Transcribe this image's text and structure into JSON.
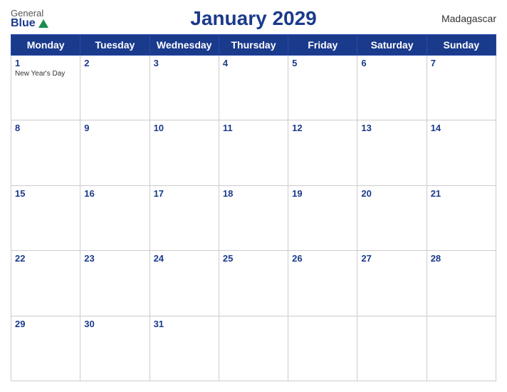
{
  "header": {
    "logo_general": "General",
    "logo_blue": "Blue",
    "title": "January 2029",
    "country": "Madagascar"
  },
  "days_of_week": [
    "Monday",
    "Tuesday",
    "Wednesday",
    "Thursday",
    "Friday",
    "Saturday",
    "Sunday"
  ],
  "weeks": [
    [
      {
        "date": "1",
        "holiday": "New Year's Day"
      },
      {
        "date": "2",
        "holiday": ""
      },
      {
        "date": "3",
        "holiday": ""
      },
      {
        "date": "4",
        "holiday": ""
      },
      {
        "date": "5",
        "holiday": ""
      },
      {
        "date": "6",
        "holiday": ""
      },
      {
        "date": "7",
        "holiday": ""
      }
    ],
    [
      {
        "date": "8",
        "holiday": ""
      },
      {
        "date": "9",
        "holiday": ""
      },
      {
        "date": "10",
        "holiday": ""
      },
      {
        "date": "11",
        "holiday": ""
      },
      {
        "date": "12",
        "holiday": ""
      },
      {
        "date": "13",
        "holiday": ""
      },
      {
        "date": "14",
        "holiday": ""
      }
    ],
    [
      {
        "date": "15",
        "holiday": ""
      },
      {
        "date": "16",
        "holiday": ""
      },
      {
        "date": "17",
        "holiday": ""
      },
      {
        "date": "18",
        "holiday": ""
      },
      {
        "date": "19",
        "holiday": ""
      },
      {
        "date": "20",
        "holiday": ""
      },
      {
        "date": "21",
        "holiday": ""
      }
    ],
    [
      {
        "date": "22",
        "holiday": ""
      },
      {
        "date": "23",
        "holiday": ""
      },
      {
        "date": "24",
        "holiday": ""
      },
      {
        "date": "25",
        "holiday": ""
      },
      {
        "date": "26",
        "holiday": ""
      },
      {
        "date": "27",
        "holiday": ""
      },
      {
        "date": "28",
        "holiday": ""
      }
    ],
    [
      {
        "date": "29",
        "holiday": ""
      },
      {
        "date": "30",
        "holiday": ""
      },
      {
        "date": "31",
        "holiday": ""
      },
      {
        "date": "",
        "holiday": ""
      },
      {
        "date": "",
        "holiday": ""
      },
      {
        "date": "",
        "holiday": ""
      },
      {
        "date": "",
        "holiday": ""
      }
    ]
  ]
}
